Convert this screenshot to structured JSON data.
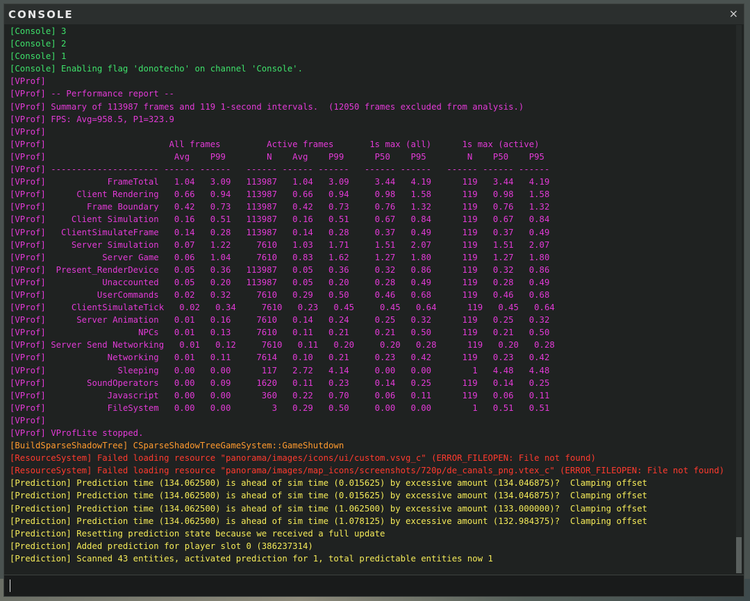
{
  "window": {
    "title": "CONSOLE",
    "close_label": "×"
  },
  "colors": {
    "Console": "#3ee06a",
    "VProf": "#e23ad6",
    "BuildSparseShadowTree": "#ff9a2e",
    "ResourceSystem": "#ff3a2e",
    "Prediction": "#f4ea58"
  },
  "log_lines": [
    {
      "channel": "Console",
      "text": "[Console] 3"
    },
    {
      "channel": "Console",
      "text": "[Console] 2"
    },
    {
      "channel": "Console",
      "text": "[Console] 1"
    },
    {
      "channel": "Console",
      "text": "[Console] Enabling flag 'donotecho' on channel 'Console'."
    },
    {
      "channel": "VProf",
      "text": "[VProf]"
    },
    {
      "channel": "VProf",
      "text": "[VProf] -- Performance report --"
    },
    {
      "channel": "VProf",
      "text": "[VProf] Summary of 113987 frames and 119 1-second intervals.  (12050 frames excluded from analysis.)"
    },
    {
      "channel": "VProf",
      "text": "[VProf] FPS: Avg=958.5, P1=323.9"
    },
    {
      "channel": "VProf",
      "text": "[VProf]"
    },
    {
      "channel": "VProf",
      "text": "[VProf]                        All frames         Active frames       1s max (all)      1s max (active)"
    },
    {
      "channel": "VProf",
      "text": "[VProf]                         Avg    P99        N    Avg    P99      P50    P95        N    P50    P95"
    },
    {
      "channel": "VProf",
      "text": "[VProf] --------------------- ------ ------   ------ ------ ------   ------ ------   ------ ------ ------"
    },
    {
      "channel": "VProf",
      "text": "[VProf]            FrameTotal   1.04   3.09   113987   1.04   3.09     3.44   4.19      119   3.44   4.19"
    },
    {
      "channel": "VProf",
      "text": "[VProf]      Client Rendering   0.66   0.94   113987   0.66   0.94     0.98   1.58      119   0.98   1.58"
    },
    {
      "channel": "VProf",
      "text": "[VProf]        Frame Boundary   0.42   0.73   113987   0.42   0.73     0.76   1.32      119   0.76   1.32"
    },
    {
      "channel": "VProf",
      "text": "[VProf]     Client Simulation   0.16   0.51   113987   0.16   0.51     0.67   0.84      119   0.67   0.84"
    },
    {
      "channel": "VProf",
      "text": "[VProf]   ClientSimulateFrame   0.14   0.28   113987   0.14   0.28     0.37   0.49      119   0.37   0.49"
    },
    {
      "channel": "VProf",
      "text": "[VProf]     Server Simulation   0.07   1.22     7610   1.03   1.71     1.51   2.07      119   1.51   2.07"
    },
    {
      "channel": "VProf",
      "text": "[VProf]           Server Game   0.06   1.04     7610   0.83   1.62     1.27   1.80      119   1.27   1.80"
    },
    {
      "channel": "VProf",
      "text": "[VProf]  Present_RenderDevice   0.05   0.36   113987   0.05   0.36     0.32   0.86      119   0.32   0.86"
    },
    {
      "channel": "VProf",
      "text": "[VProf]           Unaccounted   0.05   0.20   113987   0.05   0.20     0.28   0.49      119   0.28   0.49"
    },
    {
      "channel": "VProf",
      "text": "[VProf]          UserCommands   0.02   0.32     7610   0.29   0.50     0.46   0.68      119   0.46   0.68"
    },
    {
      "channel": "VProf",
      "text": "[VProf]     ClientSimulateTick   0.02   0.34     7610   0.23   0.45     0.45   0.64      119   0.45   0.64"
    },
    {
      "channel": "VProf",
      "text": "[VProf]      Server Animation   0.01   0.16     7610   0.14   0.24     0.25   0.32      119   0.25   0.32"
    },
    {
      "channel": "VProf",
      "text": "[VProf]                  NPCs   0.01   0.13     7610   0.11   0.21     0.21   0.50      119   0.21   0.50"
    },
    {
      "channel": "VProf",
      "text": "[VProf] Server Send Networking   0.01   0.12     7610   0.11   0.20     0.20   0.28      119   0.20   0.28"
    },
    {
      "channel": "VProf",
      "text": "[VProf]            Networking   0.01   0.11     7614   0.10   0.21     0.23   0.42      119   0.23   0.42"
    },
    {
      "channel": "VProf",
      "text": "[VProf]              Sleeping   0.00   0.00      117   2.72   4.14     0.00   0.00        1   4.48   4.48"
    },
    {
      "channel": "VProf",
      "text": "[VProf]        SoundOperators   0.00   0.09     1620   0.11   0.23     0.14   0.25      119   0.14   0.25"
    },
    {
      "channel": "VProf",
      "text": "[VProf]            Javascript   0.00   0.00      360   0.22   0.70     0.06   0.11      119   0.06   0.11"
    },
    {
      "channel": "VProf",
      "text": "[VProf]            FileSystem   0.00   0.00        3   0.29   0.50     0.00   0.00        1   0.51   0.51"
    },
    {
      "channel": "VProf",
      "text": "[VProf]"
    },
    {
      "channel": "VProf",
      "text": "[VProf] VProfLite stopped."
    },
    {
      "channel": "BuildSparseShadowTree",
      "text": "[BuildSparseShadowTree] CSparseShadowTreeGameSystem::GameShutdown"
    },
    {
      "channel": "ResourceSystem",
      "text": "[ResourceSystem] Failed loading resource \"panorama/images/icons/ui/custom.vsvg_c\" (ERROR_FILEOPEN: File not found)"
    },
    {
      "channel": "ResourceSystem",
      "text": "[ResourceSystem] Failed loading resource \"panorama/images/map_icons/screenshots/720p/de_canals_png.vtex_c\" (ERROR_FILEOPEN: File not found)"
    },
    {
      "channel": "Prediction",
      "text": "[Prediction] Prediction time (134.062500) is ahead of sim time (0.015625) by excessive amount (134.046875)?  Clamping offset"
    },
    {
      "channel": "Prediction",
      "text": "[Prediction] Prediction time (134.062500) is ahead of sim time (0.015625) by excessive amount (134.046875)?  Clamping offset"
    },
    {
      "channel": "Prediction",
      "text": "[Prediction] Prediction time (134.062500) is ahead of sim time (1.062500) by excessive amount (133.000000)?  Clamping offset"
    },
    {
      "channel": "Prediction",
      "text": "[Prediction] Prediction time (134.062500) is ahead of sim time (1.078125) by excessive amount (132.984375)?  Clamping offset"
    },
    {
      "channel": "Prediction",
      "text": "[Prediction] Resetting prediction state because we received a full update"
    },
    {
      "channel": "Prediction",
      "text": "[Prediction] Added prediction for player slot 0 (386237314)"
    },
    {
      "channel": "Prediction",
      "text": "[Prediction] Scanned 43 entities, activated prediction for 1, total predictable entities now 1"
    }
  ],
  "input": {
    "value": "",
    "placeholder": ""
  }
}
